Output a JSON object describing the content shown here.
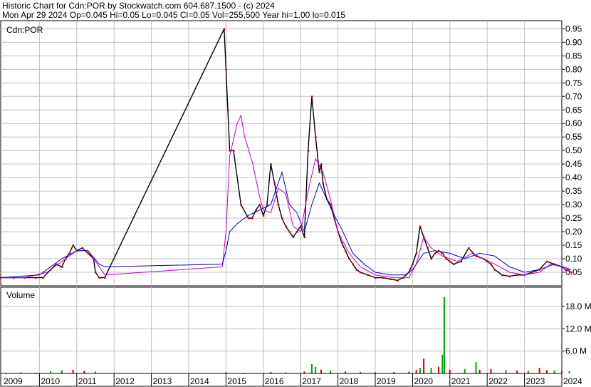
{
  "header": {
    "line1": "Historic Chart for Cdn:POR by Stockwatch.com 604.687.1500 - (c) 2024",
    "line2": "Mon Apr 29 2024  Op=0.045  Hi=0.05  Lo=0.045  Cl=0.05  Vol=255,500  Year hi=1.00  lo=0.015"
  },
  "price_panel": {
    "label": "Cdn:POR"
  },
  "volume_panel": {
    "label": "Volume"
  },
  "colors": {
    "grid": "#c0c0c0",
    "price": "#000000",
    "ma_short": "#cc0000",
    "ma_mid": "#cc00cc",
    "ma_long": "#0000cc",
    "volume_down": "#cc0000",
    "volume_up": "#00a000"
  },
  "chart_data": [
    {
      "type": "line",
      "ylim": [
        0,
        0.98
      ],
      "yticks": [
        "0.95",
        "0.90",
        "0.85",
        "0.80",
        "0.75",
        "0.70",
        "0.65",
        "0.60",
        "0.55",
        "0.50",
        "0.45",
        "0.40",
        "0.35",
        "0.30",
        "0.25",
        "0.20",
        "0.15",
        "0.10",
        "0.05"
      ],
      "ytick_values": [
        0.95,
        0.9,
        0.85,
        0.8,
        0.75,
        0.7,
        0.65,
        0.6,
        0.55,
        0.5,
        0.45,
        0.4,
        0.35,
        0.3,
        0.25,
        0.2,
        0.15,
        0.1,
        0.05
      ],
      "xticks": [
        "2009",
        "2010",
        "2011",
        "2012",
        "2013",
        "2014",
        "2015",
        "2016",
        "2017",
        "2018",
        "2019",
        "2020",
        "2021",
        "2022",
        "2023",
        "2024"
      ],
      "xtick_dates": [
        2009.0,
        2010.0,
        2011.0,
        2012.0,
        2013.0,
        2014.0,
        2015.0,
        2016.0,
        2017.0,
        2018.0,
        2019.0,
        2020.0,
        2021.0,
        2022.0,
        2023.0,
        2024.0
      ],
      "grid": true,
      "series": [
        {
          "key": "price",
          "x": [
            2008.95,
            2009.3,
            2009.6,
            2009.9,
            2010.1,
            2010.3,
            2010.45,
            2010.6,
            2010.7,
            2010.8,
            2010.9,
            2011.0,
            2011.15,
            2011.3,
            2011.45,
            2011.5,
            2011.6,
            2011.75,
            2014.95,
            2015.0,
            2015.05,
            2015.1,
            2015.2,
            2015.4,
            2015.6,
            2015.7,
            2015.8,
            2015.9,
            2016.0,
            2016.1,
            2016.2,
            2016.3,
            2016.4,
            2016.5,
            2016.6,
            2016.7,
            2016.8,
            2016.9,
            2017.0,
            2017.1,
            2017.2,
            2017.3,
            2017.4,
            2017.5,
            2017.55,
            2017.6,
            2017.7,
            2017.8,
            2017.9,
            2018.0,
            2018.1,
            2018.2,
            2018.3,
            2018.4,
            2018.5,
            2018.6,
            2018.8,
            2019.0,
            2019.2,
            2019.4,
            2019.6,
            2019.75,
            2019.9,
            2020.0,
            2020.1,
            2020.2,
            2020.3,
            2020.4,
            2020.5,
            2020.6,
            2020.7,
            2020.8,
            2020.9,
            2021.0,
            2021.1,
            2021.3,
            2021.5,
            2021.7,
            2021.9,
            2022.0,
            2022.1,
            2022.2,
            2022.4,
            2022.6,
            2022.8,
            2023.0,
            2023.2,
            2023.4,
            2023.6,
            2023.8,
            2024.0,
            2024.1,
            2024.25
          ],
          "y": [
            0.03,
            0.03,
            0.03,
            0.03,
            0.03,
            0.06,
            0.08,
            0.07,
            0.1,
            0.12,
            0.15,
            0.13,
            0.14,
            0.12,
            0.1,
            0.05,
            0.03,
            0.03,
            0.95,
            0.8,
            0.65,
            0.5,
            0.5,
            0.3,
            0.25,
            0.25,
            0.28,
            0.3,
            0.26,
            0.3,
            0.45,
            0.38,
            0.3,
            0.25,
            0.22,
            0.2,
            0.18,
            0.2,
            0.22,
            0.18,
            0.5,
            0.7,
            0.55,
            0.42,
            0.45,
            0.38,
            0.32,
            0.3,
            0.25,
            0.2,
            0.16,
            0.13,
            0.1,
            0.08,
            0.06,
            0.05,
            0.04,
            0.03,
            0.03,
            0.025,
            0.02,
            0.03,
            0.05,
            0.08,
            0.12,
            0.22,
            0.18,
            0.14,
            0.1,
            0.12,
            0.13,
            0.12,
            0.1,
            0.09,
            0.08,
            0.09,
            0.14,
            0.11,
            0.1,
            0.09,
            0.08,
            0.06,
            0.04,
            0.035,
            0.04,
            0.04,
            0.05,
            0.06,
            0.09,
            0.08,
            0.07,
            0.06,
            0.05
          ]
        },
        {
          "key": "ma_mid",
          "x": [
            2008.95,
            2009.6,
            2010.2,
            2010.7,
            2011.0,
            2011.3,
            2011.6,
            2011.75,
            2014.9,
            2015.0,
            2015.1,
            2015.3,
            2015.4,
            2015.5,
            2015.7,
            2015.9,
            2016.0,
            2016.2,
            2016.4,
            2016.6,
            2016.8,
            2017.0,
            2017.2,
            2017.4,
            2017.6,
            2017.8,
            2018.0,
            2018.3,
            2018.6,
            2019.0,
            2019.5,
            2019.9,
            2020.1,
            2020.3,
            2020.5,
            2020.8,
            2021.2,
            2021.6,
            2021.9,
            2022.2,
            2022.6,
            2023.0,
            2023.4,
            2023.7,
            2024.0,
            2024.25
          ],
          "y": [
            0.03,
            0.03,
            0.05,
            0.1,
            0.13,
            0.13,
            0.07,
            0.04,
            0.07,
            0.2,
            0.48,
            0.6,
            0.63,
            0.55,
            0.46,
            0.33,
            0.28,
            0.27,
            0.36,
            0.34,
            0.22,
            0.2,
            0.35,
            0.47,
            0.42,
            0.32,
            0.2,
            0.12,
            0.07,
            0.04,
            0.03,
            0.03,
            0.08,
            0.18,
            0.14,
            0.11,
            0.09,
            0.12,
            0.1,
            0.08,
            0.05,
            0.04,
            0.05,
            0.08,
            0.07,
            0.05
          ]
        },
        {
          "key": "ma_long",
          "x": [
            2008.95,
            2010.0,
            2010.6,
            2011.0,
            2011.3,
            2011.6,
            2011.75,
            2014.9,
            2015.0,
            2015.1,
            2015.3,
            2015.6,
            2015.9,
            2016.2,
            2016.5,
            2016.7,
            2016.9,
            2017.1,
            2017.3,
            2017.5,
            2017.7,
            2017.9,
            2018.1,
            2018.4,
            2018.7,
            2019.0,
            2019.4,
            2019.8,
            2020.0,
            2020.3,
            2020.6,
            2021.0,
            2021.4,
            2021.8,
            2022.2,
            2022.6,
            2023.0,
            2023.4,
            2023.8,
            2024.25
          ],
          "y": [
            0.03,
            0.04,
            0.1,
            0.13,
            0.13,
            0.08,
            0.07,
            0.08,
            0.13,
            0.2,
            0.23,
            0.26,
            0.28,
            0.3,
            0.42,
            0.3,
            0.27,
            0.2,
            0.3,
            0.38,
            0.32,
            0.26,
            0.21,
            0.12,
            0.08,
            0.05,
            0.04,
            0.04,
            0.06,
            0.12,
            0.13,
            0.12,
            0.1,
            0.12,
            0.11,
            0.07,
            0.05,
            0.06,
            0.08,
            0.06
          ]
        }
      ]
    },
    {
      "type": "bar",
      "ylim": [
        0,
        22
      ],
      "yticks": [
        "18.0 M",
        "12.0 M",
        "6.0 M"
      ],
      "ytick_values": [
        18,
        12,
        6
      ],
      "xticks": [
        "2009",
        "2010",
        "2011",
        "2012",
        "2013",
        "2014",
        "2015",
        "2016",
        "2017",
        "2018",
        "2019",
        "2020",
        "2021",
        "2022",
        "2023",
        "2024"
      ],
      "grid": true,
      "series": [
        {
          "key": "volume",
          "x": [
            2009.1,
            2009.5,
            2009.9,
            2010.3,
            2010.6,
            2010.9,
            2011.2,
            2011.5,
            2015.0,
            2015.5,
            2016.2,
            2016.6,
            2017.1,
            2017.3,
            2017.4,
            2017.55,
            2017.8,
            2018.2,
            2018.6,
            2019.0,
            2019.5,
            2019.9,
            2020.1,
            2020.2,
            2020.3,
            2020.5,
            2020.7,
            2020.8,
            2020.85,
            2021.0,
            2021.4,
            2021.7,
            2021.8,
            2022.1,
            2022.5,
            2022.8,
            2023.1,
            2023.4,
            2023.6,
            2023.8,
            2024.0,
            2024.2
          ],
          "y": [
            0.2,
            0.3,
            0.2,
            0.6,
            0.8,
            1.0,
            0.7,
            0.5,
            0.3,
            0.2,
            0.4,
            0.3,
            0.5,
            2.5,
            1.8,
            1.0,
            0.8,
            0.5,
            0.4,
            0.3,
            0.4,
            0.5,
            1.0,
            1.5,
            4.0,
            1.5,
            1.8,
            5.0,
            20.5,
            1.0,
            1.2,
            3.0,
            1.0,
            1.2,
            0.9,
            0.8,
            0.7,
            1.5,
            0.9,
            0.8,
            0.7,
            0.6
          ],
          "up": [
            false,
            true,
            false,
            true,
            true,
            false,
            false,
            true,
            false,
            true,
            false,
            true,
            false,
            true,
            true,
            false,
            true,
            false,
            true,
            false,
            false,
            true,
            false,
            true,
            false,
            true,
            false,
            true,
            true,
            false,
            true,
            true,
            false,
            false,
            true,
            false,
            true,
            false,
            false,
            true,
            false,
            true
          ]
        }
      ]
    }
  ]
}
